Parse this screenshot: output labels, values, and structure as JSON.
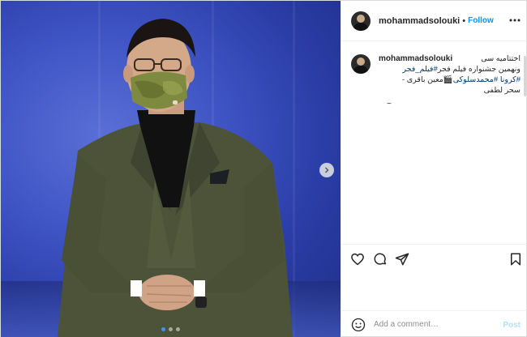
{
  "post": {
    "username": "mohammadsolouki",
    "separator": "•",
    "follow_label": "Follow",
    "image_alt": "Man in olive suit wearing a camouflage face mask on stage"
  },
  "caption": {
    "username": "mohammadsolouki",
    "line1": "اختتامیه سی",
    "line2_text": "ونهمین جشنواره فیلم فجر",
    "line2_tag": "#فیلم_فجر",
    "line3_tag1": "#کرونا",
    "line3_tag2": "#محمدسلوکی",
    "line3_text": "🎬معین باقری -",
    "line4": "سحر لطفی",
    "more": "~"
  },
  "carousel": {
    "total": 3,
    "active": 0
  },
  "add_comment": {
    "placeholder": "Add a comment…",
    "post_label": "Post"
  },
  "colors": {
    "link": "#0095f6",
    "hashtag": "#00376b",
    "accent_dot": "#3897f0"
  },
  "icons": [
    "ellipsis-icon",
    "heart-icon",
    "comment-icon",
    "share-icon",
    "bookmark-icon",
    "emoji-icon",
    "chevron-right-icon"
  ]
}
